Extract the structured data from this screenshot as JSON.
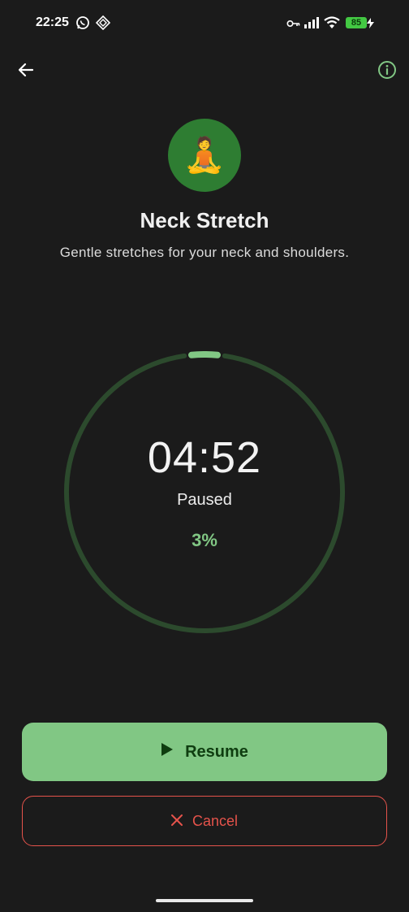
{
  "status_bar": {
    "time": "22:25",
    "battery": "85",
    "icons": [
      "whatsapp-icon",
      "diamond-app-icon",
      "key-icon",
      "signal-icon",
      "wifi-icon",
      "battery-charging-icon"
    ]
  },
  "app_bar": {
    "back_icon": "arrow-back-icon",
    "info_icon": "info-icon"
  },
  "exercise": {
    "icon": "meditation-person-emoji",
    "emoji": "🧘",
    "title": "Neck Stretch",
    "description": "Gentle stretches for your neck and shoulders."
  },
  "timer": {
    "time": "04:52",
    "state": "Paused",
    "percent_label": "3%",
    "progress": 0.03
  },
  "actions": {
    "resume_label": "Resume",
    "cancel_label": "Cancel"
  },
  "colors": {
    "background": "#1b1b1b",
    "accent": "#81c784",
    "accent_dark": "#2e7d32",
    "track": "#2c4a2d",
    "danger": "#e5534b",
    "battery": "#43c843"
  }
}
